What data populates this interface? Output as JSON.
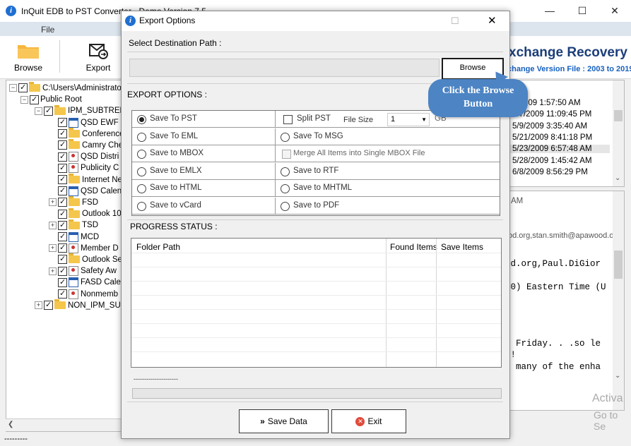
{
  "app": {
    "title": "InQuit EDB to PST Converter - Demo Version 7.5",
    "menu_file": "File",
    "minimize": "—",
    "maximize": "☐",
    "close": "✕",
    "toolbar": {
      "browse_label": "Browse",
      "export_label": "Export"
    },
    "brand_title": "xchange Recovery",
    "brand_subtitle": "change Version File : 2003 to 2019"
  },
  "tree": [
    {
      "label": "C:\\Users\\Administrator",
      "icon": "folder-icon",
      "expander": "−"
    },
    {
      "label": "Public Root",
      "icon": "",
      "expander": "−"
    },
    {
      "label": "IPM_SUBTREE",
      "icon": "folder-icon",
      "expander": "−"
    },
    {
      "label": "QSD EWF",
      "icon": "calendar-icon",
      "expander": ""
    },
    {
      "label": "Conference",
      "icon": "folder-icon",
      "expander": ""
    },
    {
      "label": "Camry Che",
      "icon": "folder-icon",
      "expander": ""
    },
    {
      "label": "QSD Distri",
      "icon": "contacts-icon",
      "expander": ""
    },
    {
      "label": "Publicity C",
      "icon": "contacts-icon",
      "expander": ""
    },
    {
      "label": "Internet Ne",
      "icon": "folder-icon",
      "expander": ""
    },
    {
      "label": "QSD Calen",
      "icon": "calendar-icon",
      "expander": ""
    },
    {
      "label": "FSD",
      "icon": "folder-icon",
      "expander": "+"
    },
    {
      "label": "Outlook 10",
      "icon": "folder-icon",
      "expander": ""
    },
    {
      "label": "TSD",
      "icon": "folder-icon",
      "expander": "+"
    },
    {
      "label": "MCD",
      "icon": "calendar-icon",
      "expander": ""
    },
    {
      "label": "Member D",
      "icon": "contacts-icon",
      "expander": "+"
    },
    {
      "label": "Outlook Se",
      "icon": "folder-icon",
      "expander": ""
    },
    {
      "label": "Safety Aw",
      "icon": "contacts-icon",
      "expander": "+"
    },
    {
      "label": "FASD Cale",
      "icon": "calendar-icon",
      "expander": ""
    },
    {
      "label": "Nonmemb",
      "icon": "contacts-icon",
      "expander": ""
    },
    {
      "label": "NON_IPM_SU",
      "icon": "folder-icon",
      "expander": "+"
    }
  ],
  "mail_dates": [
    "5/2009 1:57:50 AM",
    "5/7/2009 11:09:45 PM",
    "5/9/2009 3:35:40 AM",
    "5/21/2009 8:41:18 PM",
    "5/23/2009 6:57:48 AM",
    "5/28/2009 1:45:42 AM",
    "6/8/2009 8:56:29 PM"
  ],
  "preview": {
    "line1": "AM",
    "line2": "od.org,stan.smith@apawood.org,c",
    "line3": "od.org,Paul.DiGior",
    "line4": "00) Eastern Time (U",
    "line5": "s Friday. . .so le",
    "line6": "s!",
    "line7": "e many of the enha"
  },
  "watermark": {
    "line1": "Activa",
    "line2": "Go to Se"
  },
  "statusbar": "---------",
  "dialog": {
    "title": "Export Options",
    "dest_label": "Select Destination Path :",
    "dest_value": "",
    "browse_label": "Browse",
    "callout": "Click the Browse Button",
    "export_options_label": "EXPORT OPTIONS :",
    "options_left": [
      "Save To PST",
      "Save To EML",
      "Save to MBOX",
      "Save to EMLX",
      "Save to HTML",
      "Save to vCard"
    ],
    "selected_option": "Save To PST",
    "split_pst_label": "Split PST",
    "file_size_label": "File Size",
    "file_size_value": "1",
    "file_size_unit": "GB",
    "options_right": [
      "Save To MSG",
      "Merge All Items into Single MBOX File",
      "Save to RTF",
      "Save to MHTML",
      "Save to PDF"
    ],
    "progress_label": "PROGRESS STATUS :",
    "columns": [
      "Folder Path",
      "Found Items",
      "Save Items"
    ],
    "status_text": "---------------------",
    "progress": 0,
    "save_button": "Save Data",
    "exit_button": "Exit",
    "minimize": "—",
    "maximize": "☐",
    "close": "✕"
  },
  "colors": {
    "accent": "#4c84c4",
    "brand": "#1c3e7a",
    "menubar": "#dce4ee"
  }
}
